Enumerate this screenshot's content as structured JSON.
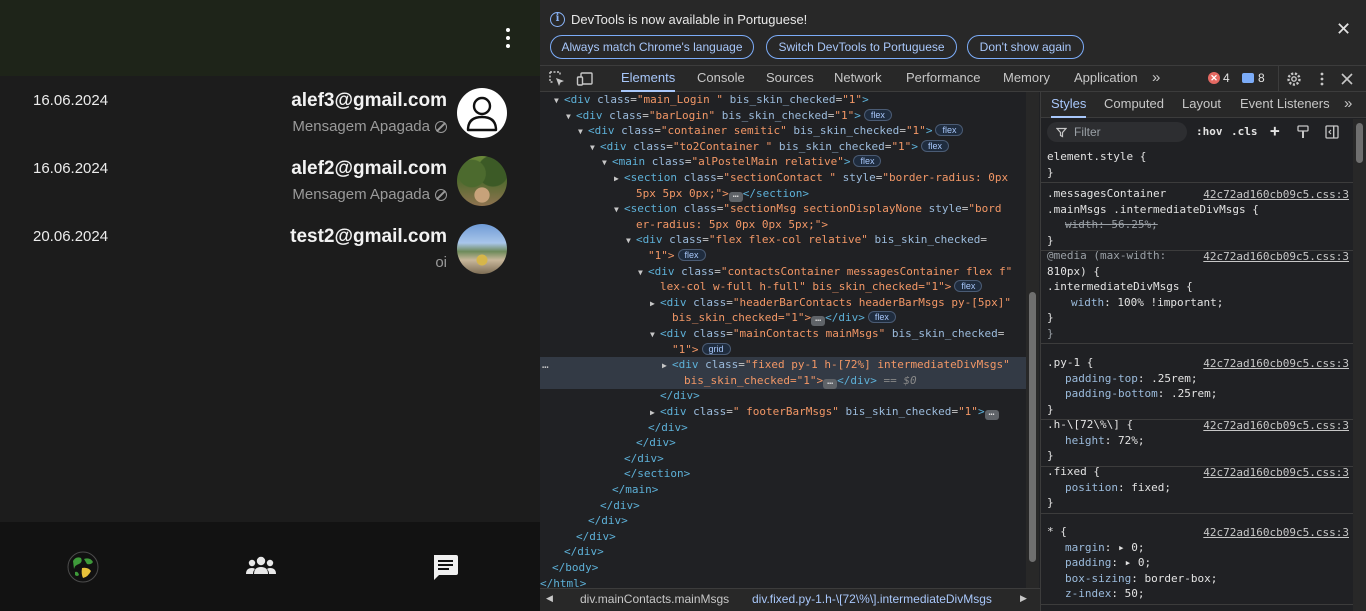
{
  "app": {
    "contacts": [
      {
        "date": "16.06.2024",
        "email": "alef3@gmail.com",
        "message": "Mensagem Apagada",
        "deleted": true,
        "avatar": "default-user-avatar"
      },
      {
        "date": "16.06.2024",
        "email": "alef2@gmail.com",
        "message": "Mensagem Apagada",
        "deleted": true,
        "avatar": "forest-photo-avatar"
      },
      {
        "date": "20.06.2024",
        "email": "test2@gmail.com",
        "message": "oi",
        "deleted": false,
        "avatar": "city-photo-avatar"
      }
    ],
    "footer": {
      "icons": [
        "globe-icon",
        "group-icon",
        "chat-icon"
      ]
    },
    "colors": {
      "header_bg": "#1e2419",
      "main_bg": "#1c1c1c",
      "footer_bg": "#121212"
    }
  },
  "devtools": {
    "infobar": {
      "text": "DevTools is now available in Portuguese!",
      "buttons": [
        "Always match Chrome's language",
        "Switch DevTools to Portuguese",
        "Don't show again"
      ]
    },
    "tabs": [
      "Elements",
      "Console",
      "Sources",
      "Network",
      "Performance",
      "Memory",
      "Application"
    ],
    "active_tab": "Elements",
    "errors": "4",
    "messages": "8",
    "dom": [
      {
        "prefix": "<",
        "tag": "div",
        "attrs": [
          [
            "class",
            "main_Login "
          ],
          [
            "bis_skin_checked",
            "1"
          ]
        ],
        "suffix": ">",
        "badge": "",
        "ell": false,
        "sel": false
      },
      {
        "prefix": "<",
        "tag": "div",
        "attrs": [
          [
            "class",
            "barLogin"
          ],
          [
            "bis_skin_checked",
            "1"
          ]
        ],
        "suffix": ">",
        "badge": "flex",
        "ell": false,
        "sel": false
      },
      {
        "prefix": "<",
        "tag": "div",
        "attrs": [
          [
            "class",
            "container semitic"
          ],
          [
            "bis_skin_checked",
            "1"
          ]
        ],
        "suffix": ">",
        "badge": "flex",
        "ell": false,
        "sel": false
      },
      {
        "prefix": "<",
        "tag": "div",
        "attrs": [
          [
            "class",
            "to2Container "
          ],
          [
            "bis_skin_checked",
            "1"
          ]
        ],
        "suffix": ">",
        "badge": "flex",
        "ell": false,
        "sel": false
      },
      {
        "prefix": "<",
        "tag": "main",
        "attrs": [
          [
            "class",
            "alPostelMain relative"
          ]
        ],
        "suffix": ">",
        "badge": "flex",
        "ell": false,
        "sel": false
      },
      {
        "prefix": "<",
        "tag": "section",
        "attrs": [
          [
            "class",
            "sectionContact "
          ],
          [
            "style",
            "border-radius: 0px"
          ]
        ],
        "suffix": "",
        "badge": "",
        "ell": false,
        "sel": false
      },
      {
        "raw": "5px 5px 0px;\">",
        "ell": true,
        "tail": "</section>"
      },
      {
        "prefix": "<",
        "tag": "section",
        "attrs": [
          [
            "class",
            "sectionMsg sectionDisplayNone"
          ],
          [
            "style",
            "bord"
          ]
        ],
        "suffix": "",
        "badge": "",
        "ell": false,
        "sel": false
      },
      {
        "raw": "er-radius: 5px 0px 0px 5px;\">",
        "ell": false,
        "tail": ""
      },
      {
        "prefix": "<",
        "tag": "div",
        "attrs": [
          [
            "class",
            "flex flex-col relative"
          ],
          [
            "bis_skin_checked",
            ""
          ]
        ],
        "suffix": "",
        "badge": "",
        "ell": false,
        "sel": false
      },
      {
        "raw": "\"1\">",
        "ell": false,
        "tail": "",
        "badge": "flex"
      },
      {
        "prefix": "<",
        "tag": "div",
        "attrs": [
          [
            "class",
            "contactsContainer messagesContainer flex f"
          ]
        ],
        "suffix": "",
        "badge": "",
        "ell": false,
        "sel": false
      },
      {
        "raw": "lex-col w-full h-full\" bis_skin_checked=\"1\">",
        "ell": false,
        "tail": "",
        "badge": "flex"
      },
      {
        "prefix": "<",
        "tag": "div",
        "attrs": [
          [
            "class",
            "headerBarContacts headerBarMsgs py-[5px]"
          ]
        ],
        "suffix": "",
        "badge": "",
        "ell": false,
        "sel": false
      },
      {
        "raw": "bis_skin_checked=\"1\">",
        "ell": true,
        "tail": "</div>",
        "badge": "flex"
      },
      {
        "prefix": "<",
        "tag": "div",
        "attrs": [
          [
            "class",
            "mainContacts mainMsgs"
          ],
          [
            "bis_skin_checked",
            ""
          ]
        ],
        "suffix": "",
        "badge": "",
        "ell": false,
        "sel": false
      },
      {
        "raw": "\"1\">",
        "ell": false,
        "tail": "",
        "badge": "grid"
      },
      {
        "prefix": "<",
        "tag": "div",
        "attrs": [
          [
            "class",
            "fixed py-1 h-[72%] intermediateDivMsgs"
          ]
        ],
        "suffix": "",
        "badge": "",
        "ell": false,
        "sel": true
      },
      {
        "raw": "bis_skin_checked=\"1\">",
        "ell": true,
        "tail": "</div>",
        "comment": "== $0",
        "sel": true
      },
      {
        "close": "</div>"
      },
      {
        "prefix": "<",
        "tag": "div",
        "attrs": [
          [
            "class",
            " footerBarMsgs"
          ],
          [
            "bis_skin_checked",
            "1"
          ]
        ],
        "suffix": ">",
        "badge": "",
        "ell": true,
        "sel": false
      },
      {
        "close": "</div>"
      },
      {
        "close": "</div>"
      },
      {
        "close": "</div>"
      },
      {
        "close": "</section>"
      },
      {
        "close": "</main>"
      },
      {
        "close": "</div>"
      },
      {
        "close": "</div>"
      },
      {
        "close": "</div>"
      },
      {
        "close": "</div>"
      },
      {
        "close": "</body>"
      },
      {
        "close": "</html>"
      }
    ],
    "breadcrumbs": [
      "div.mainContacts.mainMsgs",
      "div.fixed.py-1.h-\\[72\\%\\].intermediateDivMsgs"
    ],
    "styles": {
      "tabs": [
        "Styles",
        "Computed",
        "Layout",
        "Event Listeners"
      ],
      "filter_placeholder": "Filter",
      "hov": ":hov",
      "cls": ".cls",
      "rules": [
        {
          "lines": [
            {
              "t": "element.style {",
              "k": "sel"
            },
            {
              "t": "}",
              "k": "plain"
            }
          ],
          "src": ""
        },
        {
          "lines": [
            {
              "t": ".messagesContainer",
              "k": "sel"
            },
            {
              "t": ".mainMsgs .intermediateDivMsgs {",
              "k": "sel"
            },
            {
              "p": "width",
              "v": "56.25%;",
              "strike": true
            },
            {
              "t": "}",
              "k": "plain"
            }
          ],
          "src": "42c72ad160cb09c5.css:3"
        },
        {
          "lines": [
            {
              "t": "@media (max-width:",
              "k": "media"
            },
            {
              "t": "810px) {",
              "k": "sel"
            },
            {
              "t": " .intermediateDivMsgs {",
              "k": "sel"
            },
            {
              "p": "width",
              "v": "100% !important;",
              "extra_indent": true
            },
            {
              "t": " }",
              "k": "plain"
            },
            {
              "t": "}",
              "k": "dim"
            }
          ],
          "src": "42c72ad160cb09c5.css:3"
        },
        {
          "lines": [
            {
              "t": ".py-1 {",
              "k": "sel"
            },
            {
              "p": "padding-top",
              "v": ".25rem;"
            },
            {
              "p": "padding-bottom",
              "v": ".25rem;"
            },
            {
              "t": "}",
              "k": "plain"
            }
          ],
          "src": "42c72ad160cb09c5.css:3"
        },
        {
          "lines": [
            {
              "t": ".h-\\[72\\%\\] {",
              "k": "sel"
            },
            {
              "p": "height",
              "v": "72%;"
            },
            {
              "t": "}",
              "k": "plain"
            }
          ],
          "src": "42c72ad160cb09c5.css:3"
        },
        {
          "lines": [
            {
              "t": ".fixed {",
              "k": "sel"
            },
            {
              "p": "position",
              "v": "fixed;"
            },
            {
              "t": "}",
              "k": "plain"
            }
          ],
          "src": "42c72ad160cb09c5.css:3"
        },
        {
          "lines": [
            {
              "t": "* {",
              "k": "sel"
            },
            {
              "p": "margin",
              "v": "▸ 0;"
            },
            {
              "p": "padding",
              "v": "▸ 0;"
            },
            {
              "p": "box-sizing",
              "v": "border-box;"
            },
            {
              "p": "z-index",
              "v": "50;"
            }
          ],
          "src": "42c72ad160cb09c5.css:3"
        }
      ]
    }
  }
}
